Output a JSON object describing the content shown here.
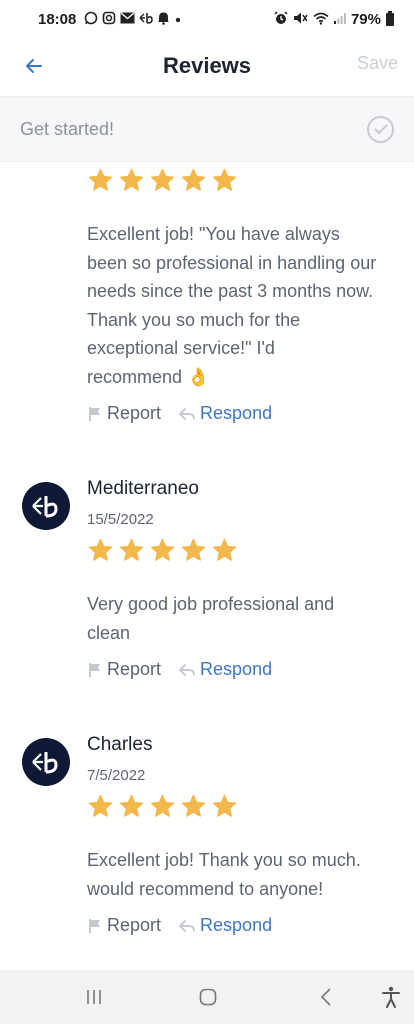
{
  "status_bar": {
    "time": "18:08",
    "left_icons": [
      "whatsapp-icon",
      "instagram-icon",
      "mail-icon",
      "app-icon",
      "bell-icon",
      "dot-icon"
    ],
    "right_icons": [
      "alarm-icon",
      "mute-icon",
      "wifi-icon",
      "signal-icon"
    ],
    "battery": "79%"
  },
  "header": {
    "title": "Reviews",
    "save_label": "Save",
    "accent_color": "#3c78c2"
  },
  "banner": {
    "label": "Get started!"
  },
  "reviews": [
    {
      "name": "",
      "date": "",
      "rating": 5,
      "lines": [
        "Excellent job! \"You have always",
        "been so professional in handling our",
        "needs since the past 3 months now.",
        "Thank you so much for the",
        "exceptional service!\" I'd",
        "recommend 👌"
      ],
      "report_label": "Report",
      "respond_label": "Respond"
    },
    {
      "name": "Mediterraneo",
      "date": "15/5/2022",
      "rating": 5,
      "lines": [
        "Very good job professional and",
        "clean"
      ],
      "report_label": "Report",
      "respond_label": "Respond"
    },
    {
      "name": "Charles",
      "date": "7/5/2022",
      "rating": 5,
      "lines": [
        "Excellent job! Thank you so much.",
        "would recommend to anyone!"
      ],
      "report_label": "Report",
      "respond_label": "Respond"
    }
  ],
  "colors": {
    "star": "#f2b84b",
    "avatar_bg": "#0e1a35",
    "respond": "#3c78c2"
  },
  "nav": {
    "buttons": [
      "recent-apps-icon",
      "home-icon",
      "back-icon",
      "accessibility-icon"
    ]
  }
}
